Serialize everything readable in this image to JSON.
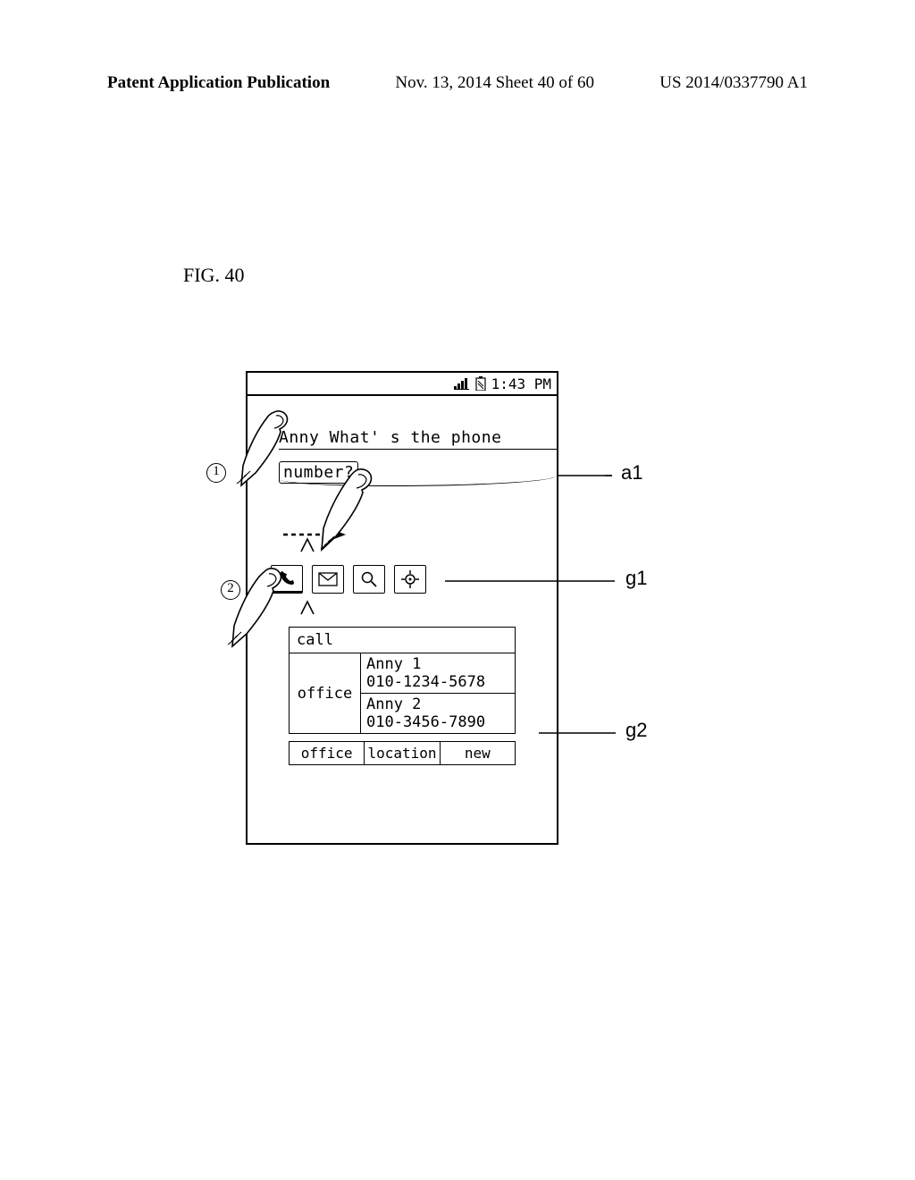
{
  "header": {
    "left": "Patent Application Publication",
    "center": "Nov. 13, 2014  Sheet 40 of 60",
    "right": "US 2014/0337790 A1"
  },
  "figure": {
    "label": "FIG. 40"
  },
  "statusbar": {
    "time": "1:43 PM"
  },
  "note": {
    "line1": "Anny What' s the phone",
    "line2": "number?"
  },
  "callpanel": {
    "header": "call",
    "category": "office",
    "contacts": [
      {
        "name": "Anny 1",
        "number": "010-1234-5678"
      },
      {
        "name": "Anny 2",
        "number": "010-3456-7890"
      }
    ],
    "tabs": [
      "office",
      "location",
      "new"
    ]
  },
  "callouts": {
    "a1": "a1",
    "g1": "g1",
    "g2": "g2",
    "step1": "1",
    "step2": "2"
  }
}
